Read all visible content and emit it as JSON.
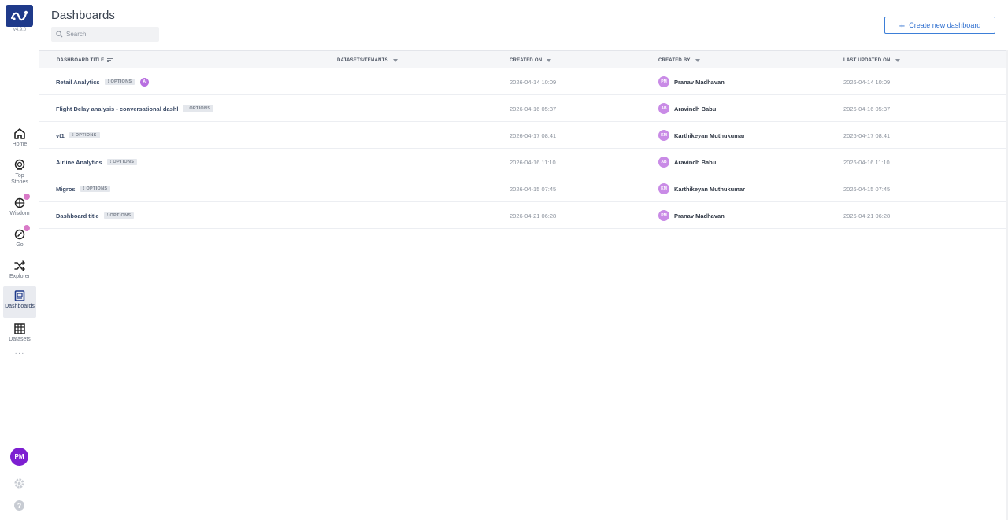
{
  "app": {
    "version": "v4.9.0",
    "nav": [
      {
        "label": "Home",
        "icon": "home-icon"
      },
      {
        "label": "Top Stories",
        "icon": "stories-icon"
      },
      {
        "label": "Wisdom",
        "icon": "wisdom-icon"
      },
      {
        "label": "Go",
        "icon": "go-icon"
      },
      {
        "label": "Explorer",
        "icon": "shuffle-icon"
      },
      {
        "label": "Dashboards",
        "icon": "dashboard-icon",
        "active": true
      },
      {
        "label": "Datasets",
        "icon": "grid-icon"
      }
    ],
    "more": "···",
    "user_initials": "PM",
    "help": "?"
  },
  "header": {
    "title": "Dashboards",
    "search_placeholder": "Search",
    "create_label": "Create new dashboard"
  },
  "table": {
    "columns": [
      "DASHBOARD TITLE",
      "DATASETS/TENANTS",
      "CREATED ON",
      "CREATED BY",
      "LAST UPDATED ON"
    ],
    "options_label": "OPTIONS",
    "ai_badge": "AI",
    "rows": [
      {
        "title": "Retail Analytics",
        "created_on": "2026-04-14 10:09",
        "initials": "PM",
        "creator": "Pranav Madhavan",
        "updated_on": "2026-04-14 10:09",
        "ai": true
      },
      {
        "title": "Flight Delay analysis - conversational dashl",
        "created_on": "2026-04-16 05:37",
        "initials": "AB",
        "creator": "Aravindh Babu",
        "updated_on": "2026-04-16 05:37"
      },
      {
        "title": "vt1",
        "created_on": "2026-04-17 08:41",
        "initials": "KM",
        "creator": "Karthikeyan Muthukumar",
        "updated_on": "2026-04-17 08:41"
      },
      {
        "title": "Airline Analytics",
        "created_on": "2026-04-16 11:10",
        "initials": "AB",
        "creator": "Aravindh Babu",
        "updated_on": "2026-04-16 11:10"
      },
      {
        "title": "Migros",
        "created_on": "2026-04-15 07:45",
        "initials": "KM",
        "creator": "Karthikeyan Muthukumar",
        "updated_on": "2026-04-15 07:45"
      },
      {
        "title": "Dashboard title",
        "created_on": "2026-04-21 06:28",
        "initials": "PM",
        "creator": "Pranav Madhavan",
        "updated_on": "2026-04-21 06:28"
      }
    ]
  },
  "colors": {
    "accent": "#2f6fcf",
    "logo_bg": "#1f3a8a",
    "user_avatar": "#7d1fd1",
    "mini_avatar": "#c98be6"
  }
}
